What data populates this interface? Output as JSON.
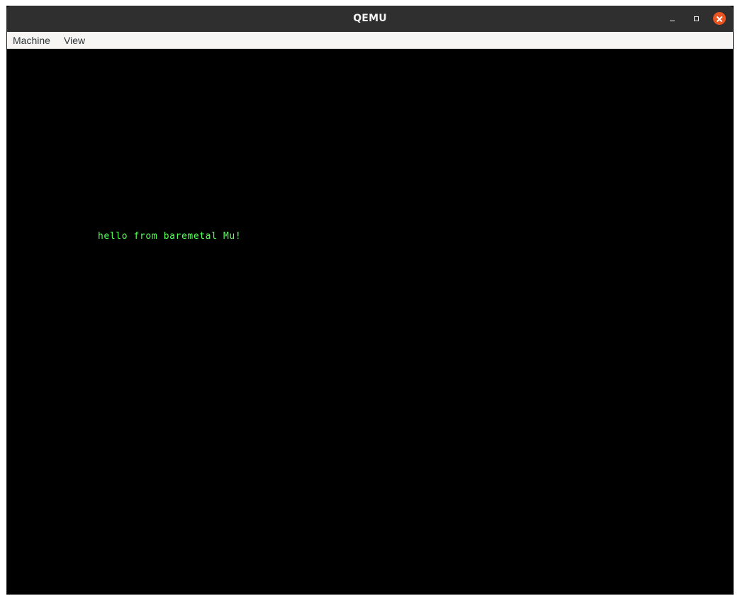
{
  "window": {
    "title": "QEMU",
    "controls": {
      "minimize_icon": "minimize-icon",
      "maximize_icon": "maximize-icon",
      "close_icon": "close-icon",
      "close_color": "#e95420"
    }
  },
  "menubar": {
    "items": [
      {
        "label": "Machine"
      },
      {
        "label": "View"
      }
    ]
  },
  "display": {
    "background": "#000000",
    "text_color": "#55ff55",
    "lines": [
      "hello from baremetal Mu!"
    ]
  }
}
